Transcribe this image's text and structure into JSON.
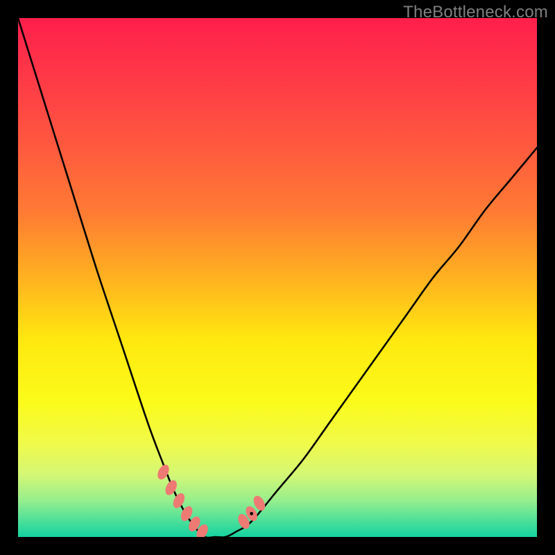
{
  "watermark": "TheBottleneck.com",
  "chart_data": {
    "type": "line",
    "title": "",
    "xlabel": "",
    "ylabel": "",
    "xlim": [
      0,
      100
    ],
    "ylim": [
      0,
      100
    ],
    "series": [
      {
        "name": "bottleneck-curve",
        "type": "line",
        "x": [
          0,
          5,
          10,
          15,
          20,
          25,
          28,
          30,
          32,
          34,
          36,
          38,
          40,
          42,
          45,
          50,
          55,
          60,
          65,
          70,
          75,
          80,
          85,
          90,
          95,
          100
        ],
        "y": [
          100,
          84,
          68,
          52,
          37,
          22,
          14,
          9,
          5,
          2,
          0,
          0,
          0,
          1,
          3,
          9,
          15,
          22,
          29,
          36,
          43,
          50,
          56,
          63,
          69,
          75
        ]
      },
      {
        "name": "marker-cluster-left",
        "type": "scatter",
        "x": [
          28,
          29.5,
          31,
          32.5,
          34,
          35.5
        ],
        "y": [
          12.5,
          9.5,
          7,
          4.5,
          2.5,
          1
        ]
      },
      {
        "name": "marker-cluster-right",
        "type": "scatter",
        "x": [
          43.5,
          45,
          46.5
        ],
        "y": [
          3,
          4.5,
          6.5
        ]
      },
      {
        "name": "black-dot",
        "type": "scatter",
        "x": [
          45
        ],
        "y": [
          4.5
        ]
      }
    ],
    "gradient_stops": [
      {
        "offset": 0.0,
        "color": "#ff1f4b"
      },
      {
        "offset": 0.12,
        "color": "#ff3a47"
      },
      {
        "offset": 0.25,
        "color": "#ff5a3e"
      },
      {
        "offset": 0.38,
        "color": "#ff7d33"
      },
      {
        "offset": 0.5,
        "color": "#ffb120"
      },
      {
        "offset": 0.62,
        "color": "#ffe80f"
      },
      {
        "offset": 0.74,
        "color": "#fbfb1a"
      },
      {
        "offset": 0.82,
        "color": "#f0fa4a"
      },
      {
        "offset": 0.88,
        "color": "#d4f775"
      },
      {
        "offset": 0.93,
        "color": "#96ee8d"
      },
      {
        "offset": 0.97,
        "color": "#4adf9a"
      },
      {
        "offset": 1.0,
        "color": "#15d39f"
      }
    ],
    "marker_color": "#ee7a74",
    "line_color": "#000000"
  }
}
